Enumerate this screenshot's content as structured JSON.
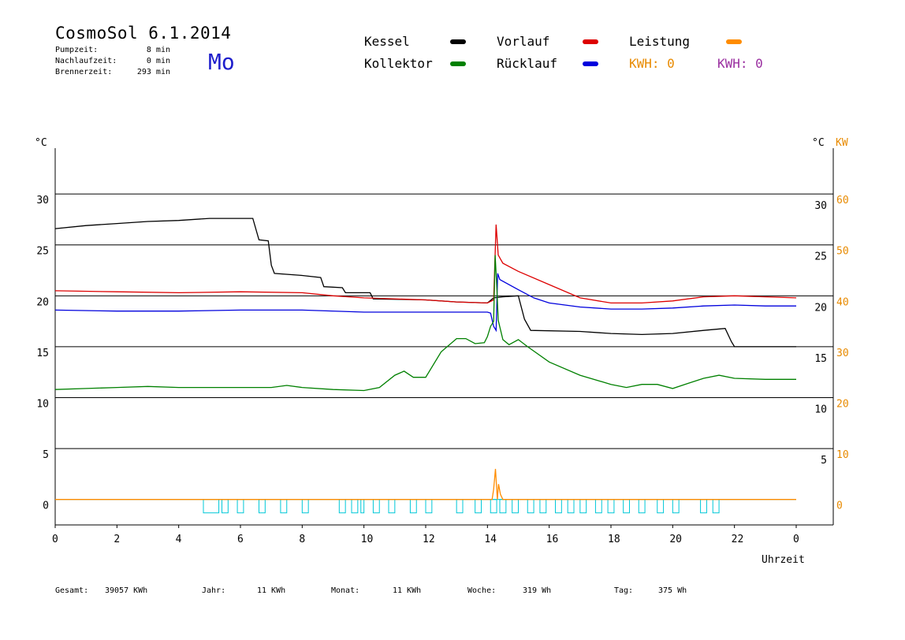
{
  "header": {
    "title": "CosmoSol 6.1.2014",
    "day": "Mo",
    "stats": [
      {
        "label": "Pumpzeit:",
        "value": "8 min"
      },
      {
        "label": "Nachlaufzeit:",
        "value": "0 min"
      },
      {
        "label": "Brennerzeit:",
        "value": "293 min"
      }
    ]
  },
  "legend": {
    "items": [
      {
        "label": "Kessel",
        "color": "#000000"
      },
      {
        "label": "Vorlauf",
        "color": "#dd0000"
      },
      {
        "label": "Leistung",
        "color": "#ff8c00"
      },
      {
        "label": "Kollektor",
        "color": "#008000"
      },
      {
        "label": "Rücklauf",
        "color": "#0000dd"
      }
    ],
    "kwh": [
      {
        "text": "KWH: 0",
        "color": "#e88a00"
      },
      {
        "text": "KWH: 0",
        "color": "#9a2fa0"
      }
    ]
  },
  "footer": [
    {
      "label": "Gesamt:",
      "value": "39057 KWh"
    },
    {
      "label": "Jahr:",
      "value": "11 KWh"
    },
    {
      "label": "Monat:",
      "value": "11 KWh"
    },
    {
      "label": "Woche:",
      "value": "319 Wh"
    },
    {
      "label": "Tag:",
      "value": "375 Wh"
    }
  ],
  "chart_data": {
    "type": "line",
    "xlabel": "Uhrzeit",
    "x_ticks": [
      "0",
      "2",
      "4",
      "6",
      "8",
      "10",
      "12",
      "14",
      "16",
      "18",
      "20",
      "22",
      "0"
    ],
    "xlim": [
      0,
      24
    ],
    "left_axis": {
      "unit": "°C",
      "ticks": [
        "30",
        "25",
        "20",
        "15",
        "10",
        "5",
        "0"
      ],
      "ylim": [
        -2.5,
        34.5
      ]
    },
    "right_axis": {
      "unit": "°C",
      "ticks": [
        "30",
        "25",
        "20",
        "15",
        "10",
        "5"
      ]
    },
    "power_axis": {
      "unit": "KW",
      "ticks": [
        "60",
        "50",
        "40",
        "30",
        "20",
        "10",
        "0"
      ],
      "ylim": [
        -5,
        69
      ],
      "color": "#e88a00"
    },
    "grid": true,
    "series": [
      {
        "name": "Kessel",
        "color": "#000000",
        "points": [
          [
            0,
            26.6
          ],
          [
            1,
            26.9
          ],
          [
            2,
            27.1
          ],
          [
            3,
            27.3
          ],
          [
            4,
            27.4
          ],
          [
            5,
            27.6
          ],
          [
            6.4,
            27.6
          ],
          [
            6.6,
            25.5
          ],
          [
            6.9,
            25.4
          ],
          [
            7.0,
            23.0
          ],
          [
            7.1,
            22.2
          ],
          [
            8.0,
            22.0
          ],
          [
            8.6,
            21.8
          ],
          [
            8.7,
            20.9
          ],
          [
            9.3,
            20.8
          ],
          [
            9.4,
            20.3
          ],
          [
            10.2,
            20.3
          ],
          [
            10.3,
            19.7
          ],
          [
            12,
            19.6
          ],
          [
            13,
            19.4
          ],
          [
            14,
            19.3
          ],
          [
            14.2,
            19.8
          ],
          [
            14.5,
            19.9
          ],
          [
            15.0,
            20.0
          ],
          [
            15.2,
            17.7
          ],
          [
            15.4,
            16.6
          ],
          [
            17,
            16.5
          ],
          [
            18,
            16.3
          ],
          [
            19,
            16.2
          ],
          [
            20,
            16.3
          ],
          [
            21,
            16.6
          ],
          [
            21.7,
            16.8
          ],
          [
            21.9,
            15.5
          ],
          [
            22.0,
            15.0
          ],
          [
            23,
            15.0
          ],
          [
            24,
            15.0
          ]
        ]
      },
      {
        "name": "Vorlauf",
        "color": "#dd0000",
        "points": [
          [
            0,
            20.5
          ],
          [
            2,
            20.4
          ],
          [
            4,
            20.3
          ],
          [
            6,
            20.4
          ],
          [
            8,
            20.3
          ],
          [
            9,
            20.0
          ],
          [
            10,
            19.8
          ],
          [
            12,
            19.6
          ],
          [
            13,
            19.4
          ],
          [
            14,
            19.3
          ],
          [
            14.2,
            19.6
          ],
          [
            14.28,
            27.0
          ],
          [
            14.35,
            24.0
          ],
          [
            14.5,
            23.2
          ],
          [
            15,
            22.4
          ],
          [
            16,
            21.1
          ],
          [
            17,
            19.8
          ],
          [
            18,
            19.3
          ],
          [
            19,
            19.3
          ],
          [
            20,
            19.5
          ],
          [
            21,
            19.9
          ],
          [
            22,
            20.0
          ],
          [
            23,
            19.9
          ],
          [
            24,
            19.8
          ]
        ]
      },
      {
        "name": "Rücklauf",
        "color": "#0000dd",
        "points": [
          [
            0,
            18.6
          ],
          [
            2,
            18.5
          ],
          [
            4,
            18.5
          ],
          [
            6,
            18.6
          ],
          [
            8,
            18.6
          ],
          [
            10,
            18.4
          ],
          [
            12,
            18.4
          ],
          [
            14,
            18.4
          ],
          [
            14.1,
            18.3
          ],
          [
            14.2,
            17.0
          ],
          [
            14.28,
            16.6
          ],
          [
            14.33,
            22.2
          ],
          [
            14.4,
            21.6
          ],
          [
            15,
            20.6
          ],
          [
            15.5,
            19.8
          ],
          [
            16,
            19.3
          ],
          [
            17,
            18.9
          ],
          [
            18,
            18.7
          ],
          [
            19,
            18.7
          ],
          [
            20,
            18.8
          ],
          [
            21,
            19.0
          ],
          [
            22,
            19.1
          ],
          [
            23,
            19.0
          ],
          [
            24,
            19.0
          ]
        ]
      },
      {
        "name": "Kollektor",
        "color": "#008000",
        "points": [
          [
            0,
            10.8
          ],
          [
            1,
            10.9
          ],
          [
            2,
            11.0
          ],
          [
            3,
            11.1
          ],
          [
            4,
            11.0
          ],
          [
            5,
            11.0
          ],
          [
            6,
            11.0
          ],
          [
            7,
            11.0
          ],
          [
            7.5,
            11.2
          ],
          [
            8,
            11.0
          ],
          [
            9,
            10.8
          ],
          [
            10,
            10.7
          ],
          [
            10.5,
            11.0
          ],
          [
            11,
            12.2
          ],
          [
            11.3,
            12.6
          ],
          [
            11.6,
            12.0
          ],
          [
            12,
            12.0
          ],
          [
            12.5,
            14.5
          ],
          [
            13,
            15.8
          ],
          [
            13.3,
            15.8
          ],
          [
            13.6,
            15.3
          ],
          [
            13.9,
            15.4
          ],
          [
            14.0,
            16.0
          ],
          [
            14.1,
            17.0
          ],
          [
            14.2,
            17.5
          ],
          [
            14.25,
            24.0
          ],
          [
            14.3,
            21.0
          ],
          [
            14.35,
            17.6
          ],
          [
            14.5,
            15.7
          ],
          [
            14.7,
            15.2
          ],
          [
            15.0,
            15.7
          ],
          [
            15.3,
            15.0
          ],
          [
            16,
            13.5
          ],
          [
            17,
            12.2
          ],
          [
            18,
            11.3
          ],
          [
            18.5,
            11.0
          ],
          [
            19,
            11.3
          ],
          [
            19.5,
            11.3
          ],
          [
            20,
            10.9
          ],
          [
            20.5,
            11.4
          ],
          [
            21,
            11.9
          ],
          [
            21.5,
            12.2
          ],
          [
            22,
            11.9
          ],
          [
            23,
            11.8
          ],
          [
            24,
            11.8
          ]
        ]
      }
    ],
    "leistung_series": {
      "name": "Leistung",
      "color": "#ff8c00",
      "unit": "KW",
      "points": [
        [
          0,
          0
        ],
        [
          14.15,
          0
        ],
        [
          14.2,
          2
        ],
        [
          14.26,
          6
        ],
        [
          14.32,
          0
        ],
        [
          14.36,
          3
        ],
        [
          14.42,
          1
        ],
        [
          14.5,
          0
        ],
        [
          24,
          0
        ]
      ]
    },
    "pump_series": {
      "color": "#00c8d8",
      "on_intervals": [
        [
          4.8,
          5.3
        ],
        [
          5.4,
          5.6
        ],
        [
          5.9,
          6.1
        ],
        [
          6.6,
          6.8
        ],
        [
          7.3,
          7.5
        ],
        [
          8.0,
          8.2
        ],
        [
          9.2,
          9.4
        ],
        [
          9.6,
          9.8
        ],
        [
          9.9,
          10.0
        ],
        [
          10.3,
          10.5
        ],
        [
          10.8,
          11.0
        ],
        [
          11.5,
          11.7
        ],
        [
          12.0,
          12.2
        ],
        [
          13.0,
          13.2
        ],
        [
          13.6,
          13.8
        ],
        [
          14.1,
          14.3
        ],
        [
          14.4,
          14.6
        ],
        [
          14.8,
          15.0
        ],
        [
          15.3,
          15.5
        ],
        [
          15.7,
          15.9
        ],
        [
          16.2,
          16.4
        ],
        [
          16.6,
          16.8
        ],
        [
          17.0,
          17.2
        ],
        [
          17.5,
          17.7
        ],
        [
          17.9,
          18.1
        ],
        [
          18.4,
          18.6
        ],
        [
          18.9,
          19.1
        ],
        [
          19.5,
          19.7
        ],
        [
          20.0,
          20.2
        ],
        [
          20.9,
          21.1
        ],
        [
          21.3,
          21.5
        ]
      ]
    }
  }
}
